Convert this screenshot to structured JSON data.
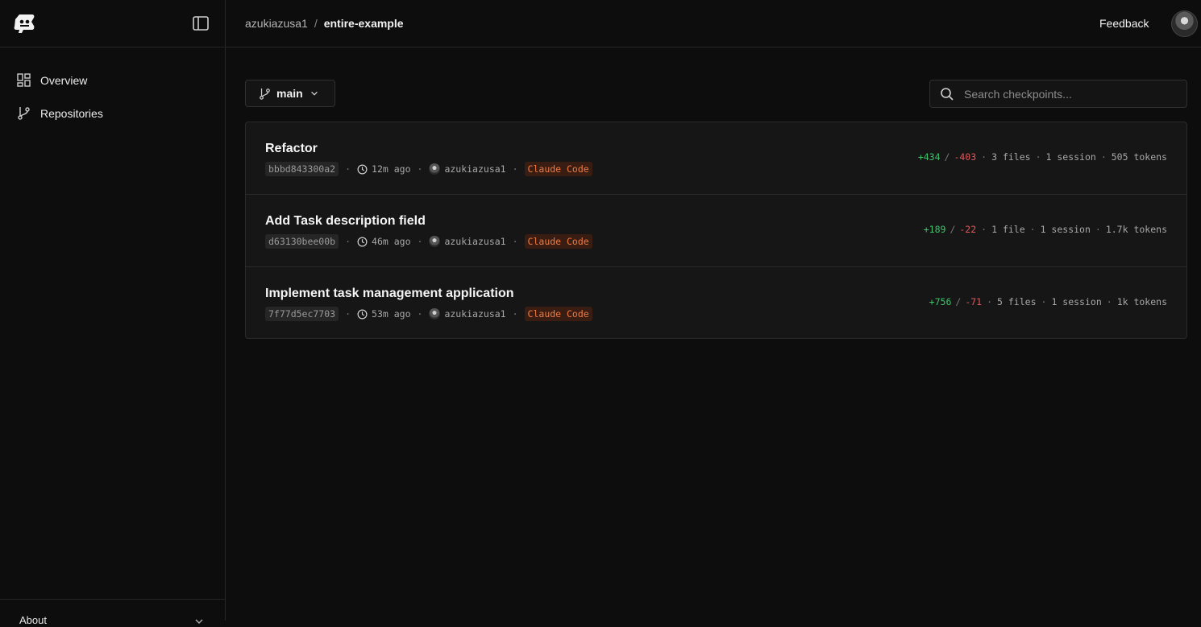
{
  "app": {
    "logo_icon": "entire-logo-icon",
    "collapse_icon": "sidebar-toggle-icon"
  },
  "sidebar": {
    "items": [
      {
        "label": "Overview",
        "icon": "dashboard-grid-icon"
      },
      {
        "label": "Repositories",
        "icon": "git-branch-icon"
      }
    ],
    "footer": {
      "label": "About",
      "icon": "chevron-down-icon"
    }
  },
  "header": {
    "owner": "azukiazusa1",
    "separator": "/",
    "repo": "entire-example",
    "feedback": "Feedback"
  },
  "toolbar": {
    "branch": "main",
    "search_placeholder": "Search checkpoints..."
  },
  "checkpoints": [
    {
      "title": "Refactor",
      "hash": "bbbd843300a2",
      "time": "12m ago",
      "author": "azukiazusa1",
      "agent": "Claude Code",
      "additions": "+434",
      "deletions": "-403",
      "files": "3 files",
      "sessions": "1 session",
      "tokens": "505 tokens"
    },
    {
      "title": "Add Task description field",
      "hash": "d63130bee00b",
      "time": "46m ago",
      "author": "azukiazusa1",
      "agent": "Claude Code",
      "additions": "+189",
      "deletions": "-22",
      "files": "1 file",
      "sessions": "1 session",
      "tokens": "1.7k tokens"
    },
    {
      "title": "Implement task management application",
      "hash": "7f77d5ec7703",
      "time": "53m ago",
      "author": "azukiazusa1",
      "agent": "Claude Code",
      "additions": "+756",
      "deletions": "-71",
      "files": "5 files",
      "sessions": "1 session",
      "tokens": "1k tokens"
    }
  ],
  "colors": {
    "additions": "#3fc36b",
    "deletions": "#e0585b",
    "agent_badge": "#ef7b43"
  }
}
